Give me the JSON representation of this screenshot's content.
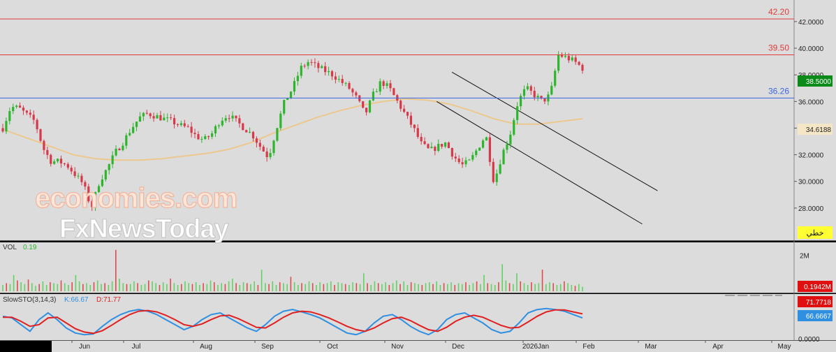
{
  "watermark": {
    "line1": "economies.com",
    "line2": "FxNewsToday"
  },
  "badge_label": "خطي",
  "colors": {
    "bg": "#dcdcdc",
    "up": "#2db52d",
    "down": "#d63a4a",
    "ma": "#ecc88f",
    "resistance": "#e03a3a",
    "support": "#3a66e0",
    "vol_up": "#62d262",
    "vol_down": "#e04a4a",
    "k_line": "#2f8fe0",
    "d_line": "#e02020"
  },
  "chart_data": [
    {
      "type": "candlestick",
      "panel": "price",
      "ylim": [
        26.0,
        43.2
      ],
      "y_ticks": [
        "42.0000",
        "40.0000",
        "38.0000",
        "36.0000",
        "34.0000",
        "32.0000",
        "30.0000",
        "28.0000"
      ],
      "x_ticks": [
        "Jun",
        "Jul",
        "Aug",
        "Sep",
        "Oct",
        "Nov",
        "Dec",
        "2026Jan",
        "Feb",
        "Mar",
        "Apr",
        "May"
      ],
      "levels": [
        {
          "value": 42.2,
          "label": "42.20",
          "role": "resistance"
        },
        {
          "value": 39.5,
          "label": "39.50",
          "role": "resistance"
        },
        {
          "value": 36.26,
          "label": "36.26",
          "role": "support"
        }
      ],
      "last_price": "38.5000",
      "ma_value": "34.6188",
      "channel": {
        "upper": [
          {
            "x": "2025-11-01",
            "y": 38.2
          },
          {
            "x": "2026-02-03",
            "y": 29.3
          }
        ],
        "lower": [
          {
            "x": "2025-10-25",
            "y": 36.0
          },
          {
            "x": "2026-01-27",
            "y": 26.8
          }
        ]
      },
      "ma_series": [
        33.8,
        33.2,
        32.6,
        32.0,
        31.7,
        31.6,
        31.6,
        31.7,
        31.9,
        32.1,
        32.4,
        32.9,
        33.6,
        34.2,
        34.8,
        35.3,
        35.7,
        36.0,
        36.2,
        36.1,
        35.8,
        35.3,
        34.7,
        34.3,
        34.3,
        34.5,
        34.7
      ],
      "price_path": [
        34.0,
        35.6,
        35.5,
        35.0,
        34.5,
        32.5,
        31.5,
        31.5,
        31.2,
        30.5,
        29.8,
        28.0,
        30.0,
        31.0,
        32.2,
        33.0,
        34.0,
        34.8,
        35.1,
        34.9,
        34.7,
        34.5,
        34.2,
        34.0,
        33.4,
        33.1,
        33.6,
        34.6,
        35.0,
        34.5,
        34.0,
        33.5,
        32.6,
        31.8,
        34.0,
        36.0,
        37.0,
        38.5,
        39.0,
        38.6,
        38.3,
        38.0,
        37.5,
        37.0,
        36.2,
        35.0,
        36.5,
        37.5,
        37.0,
        36.0,
        35.0,
        34.0,
        32.8,
        32.3,
        32.6,
        32.9,
        31.9,
        31.2,
        31.5,
        32.5,
        33.5,
        29.9,
        32.0,
        33.5,
        36.0,
        37.0,
        36.5,
        36.0,
        36.5,
        39.5,
        39.3,
        39.0,
        38.5
      ]
    },
    {
      "type": "bar",
      "panel": "volume",
      "title": "VOL",
      "value_label": "0.19",
      "ylim": [
        0,
        2.6
      ],
      "y_ticks": [
        "2M"
      ],
      "last_value": "0.1942M",
      "values": [
        0.35,
        0.45,
        0.4,
        0.9,
        0.6,
        0.5,
        0.4,
        0.65,
        0.45,
        0.3,
        0.4,
        0.55,
        0.35,
        0.5,
        0.45,
        0.4,
        0.6,
        0.45,
        0.35,
        0.5,
        0.9,
        0.55,
        0.4,
        0.45,
        0.35,
        0.5,
        0.6,
        0.4,
        0.45,
        0.35,
        0.55,
        2.3,
        0.7,
        0.45,
        0.4,
        0.4,
        0.55,
        0.45,
        0.35,
        0.4,
        0.6,
        0.55,
        0.45,
        0.35,
        0.5,
        0.4,
        0.7,
        0.45,
        0.35,
        0.4,
        0.55,
        0.45,
        0.4,
        0.5,
        0.35,
        0.45,
        0.4,
        0.6,
        0.5,
        0.35,
        0.45,
        0.4,
        0.55,
        0.7,
        0.45,
        0.35,
        0.5,
        0.45,
        0.4,
        0.55,
        0.35,
        1.2,
        0.45,
        0.4,
        0.55,
        0.35,
        0.5,
        0.45,
        0.4,
        0.8,
        0.5,
        0.35,
        0.45,
        0.4,
        0.55,
        0.45,
        0.35,
        0.5,
        0.4,
        0.45,
        0.55,
        0.35,
        0.5,
        0.45,
        0.4,
        0.35,
        0.5,
        0.45,
        0.4,
        1.0,
        0.45,
        0.35,
        0.55,
        0.45,
        0.4,
        0.5,
        0.35,
        0.45,
        0.6,
        0.4,
        0.55,
        0.35,
        0.5,
        0.45,
        0.4,
        0.35,
        0.45,
        0.5,
        0.4,
        0.55,
        0.35,
        0.45,
        0.4,
        0.5,
        0.35,
        0.45,
        0.4,
        0.5,
        0.35,
        0.45,
        0.55,
        0.4,
        0.9,
        0.45,
        0.4,
        0.35,
        0.5,
        1.5,
        0.6,
        0.45,
        0.4,
        1.0,
        0.55,
        0.45,
        0.35,
        0.5,
        0.4,
        0.45,
        1.2,
        0.4,
        0.5,
        0.45,
        0.35,
        0.4,
        0.55,
        0.45,
        0.35,
        0.3,
        0.4,
        0.25
      ]
    },
    {
      "type": "line",
      "panel": "oscillator",
      "title": "SlowSTO(3,14,3)",
      "series": [
        {
          "name": "K:66.67",
          "last": "66.6667",
          "values": [
            65,
            60,
            40,
            20,
            55,
            75,
            55,
            30,
            15,
            10,
            12,
            35,
            55,
            70,
            80,
            85,
            80,
            70,
            55,
            40,
            25,
            35,
            55,
            70,
            75,
            60,
            45,
            30,
            20,
            40,
            65,
            80,
            85,
            78,
            70,
            60,
            45,
            30,
            15,
            10,
            20,
            45,
            65,
            70,
            55,
            35,
            20,
            10,
            25,
            55,
            70,
            75,
            60,
            45,
            25,
            15,
            20,
            45,
            75,
            85,
            88,
            85,
            80,
            70,
            60
          ]
        },
        {
          "name": "D:71.77",
          "last": "71.7718",
          "values": [
            62,
            62,
            50,
            35,
            40,
            60,
            62,
            45,
            28,
            18,
            14,
            22,
            38,
            55,
            70,
            80,
            82,
            78,
            68,
            55,
            40,
            35,
            42,
            55,
            66,
            68,
            58,
            45,
            32,
            30,
            45,
            62,
            75,
            80,
            78,
            70,
            60,
            48,
            35,
            25,
            20,
            30,
            45,
            58,
            62,
            52,
            38,
            25,
            20,
            32,
            50,
            62,
            68,
            62,
            50,
            38,
            30,
            32,
            48,
            65,
            78,
            84,
            84,
            78,
            72
          ]
        }
      ],
      "ylim": [
        0,
        100
      ],
      "y_ticks": [
        "0.0000"
      ]
    }
  ]
}
